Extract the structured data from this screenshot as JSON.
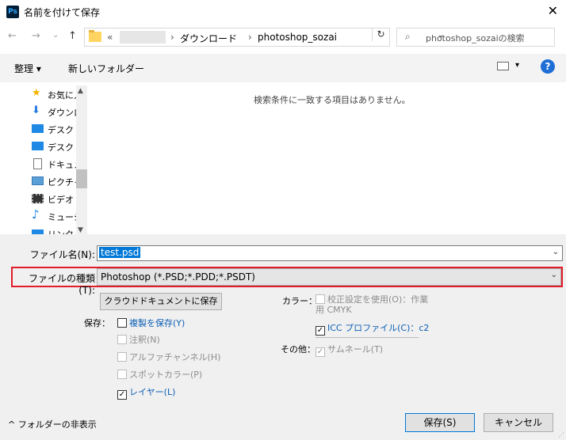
{
  "window": {
    "app_badge": "Ps",
    "title": "名前を付けて保存",
    "close_glyph": "✕"
  },
  "nav_buttons": {
    "back": "←",
    "forward": "→",
    "recent": "⌄",
    "up": "↑"
  },
  "address": {
    "overflow": "«",
    "crumbs": [
      "ダウンロード",
      "photoshop_sozai"
    ],
    "separator": "›",
    "dropdown": "⌄",
    "refresh": "↻"
  },
  "search": {
    "placeholder": "photoshop_sozaiの検索",
    "icon": "search-icon"
  },
  "toolbar": {
    "organize": "整理 ▾",
    "new_folder": "新しいフォルダー",
    "view_dropdown": "▾",
    "help": "?"
  },
  "nav_pane": {
    "items": [
      {
        "label": "お気に入り",
        "icon": "star-icon"
      },
      {
        "label": "ダウンロード",
        "icon": "download-arrow-icon"
      },
      {
        "label": "デスクトップ",
        "icon": "desktop-icon"
      },
      {
        "label": "デスクトップ",
        "icon": "desktop-icon"
      },
      {
        "label": "ドキュメント",
        "icon": "document-icon"
      },
      {
        "label": "ピクチャ",
        "icon": "pictures-icon"
      },
      {
        "label": "ビデオ",
        "icon": "video-icon"
      },
      {
        "label": "ミュージック",
        "icon": "music-icon"
      },
      {
        "label": "リンク",
        "icon": "link-icon"
      }
    ]
  },
  "file_list": {
    "empty_message": "検索条件に一致する項目はありません。"
  },
  "form": {
    "filename_label": "ファイル名(N):",
    "filename_value": "test.psd",
    "filetype_label": "ファイルの種類(T):",
    "filetype_value": "Photoshop (*.PSD;*.PDD;*.PSDT)"
  },
  "options": {
    "cloud_button": "クラウドドキュメントに保存",
    "save_label": "保存：",
    "save_copy": "複製を保存(Y)",
    "notes": "注釈(N)",
    "alpha": "アルファチャンネル(H)",
    "spot": "スポットカラー(P)",
    "layers": "レイヤー(L)",
    "color_label": "カラー：",
    "proof": "校正設定を使用(O)：作業用 CMYK",
    "icc": "ICC プロファイル(C)：c2",
    "other_label": "その他：",
    "thumbnail": "サムネール(T)",
    "check_glyph": "✓"
  },
  "footer": {
    "hide_folders": "^ フォルダーの非表示",
    "save_button": "保存(S)",
    "cancel_button": "キャンセル"
  },
  "colors": {
    "highlight_border": "#e11d2b",
    "selection": "#0078d7",
    "link": "#0b5fb5"
  }
}
